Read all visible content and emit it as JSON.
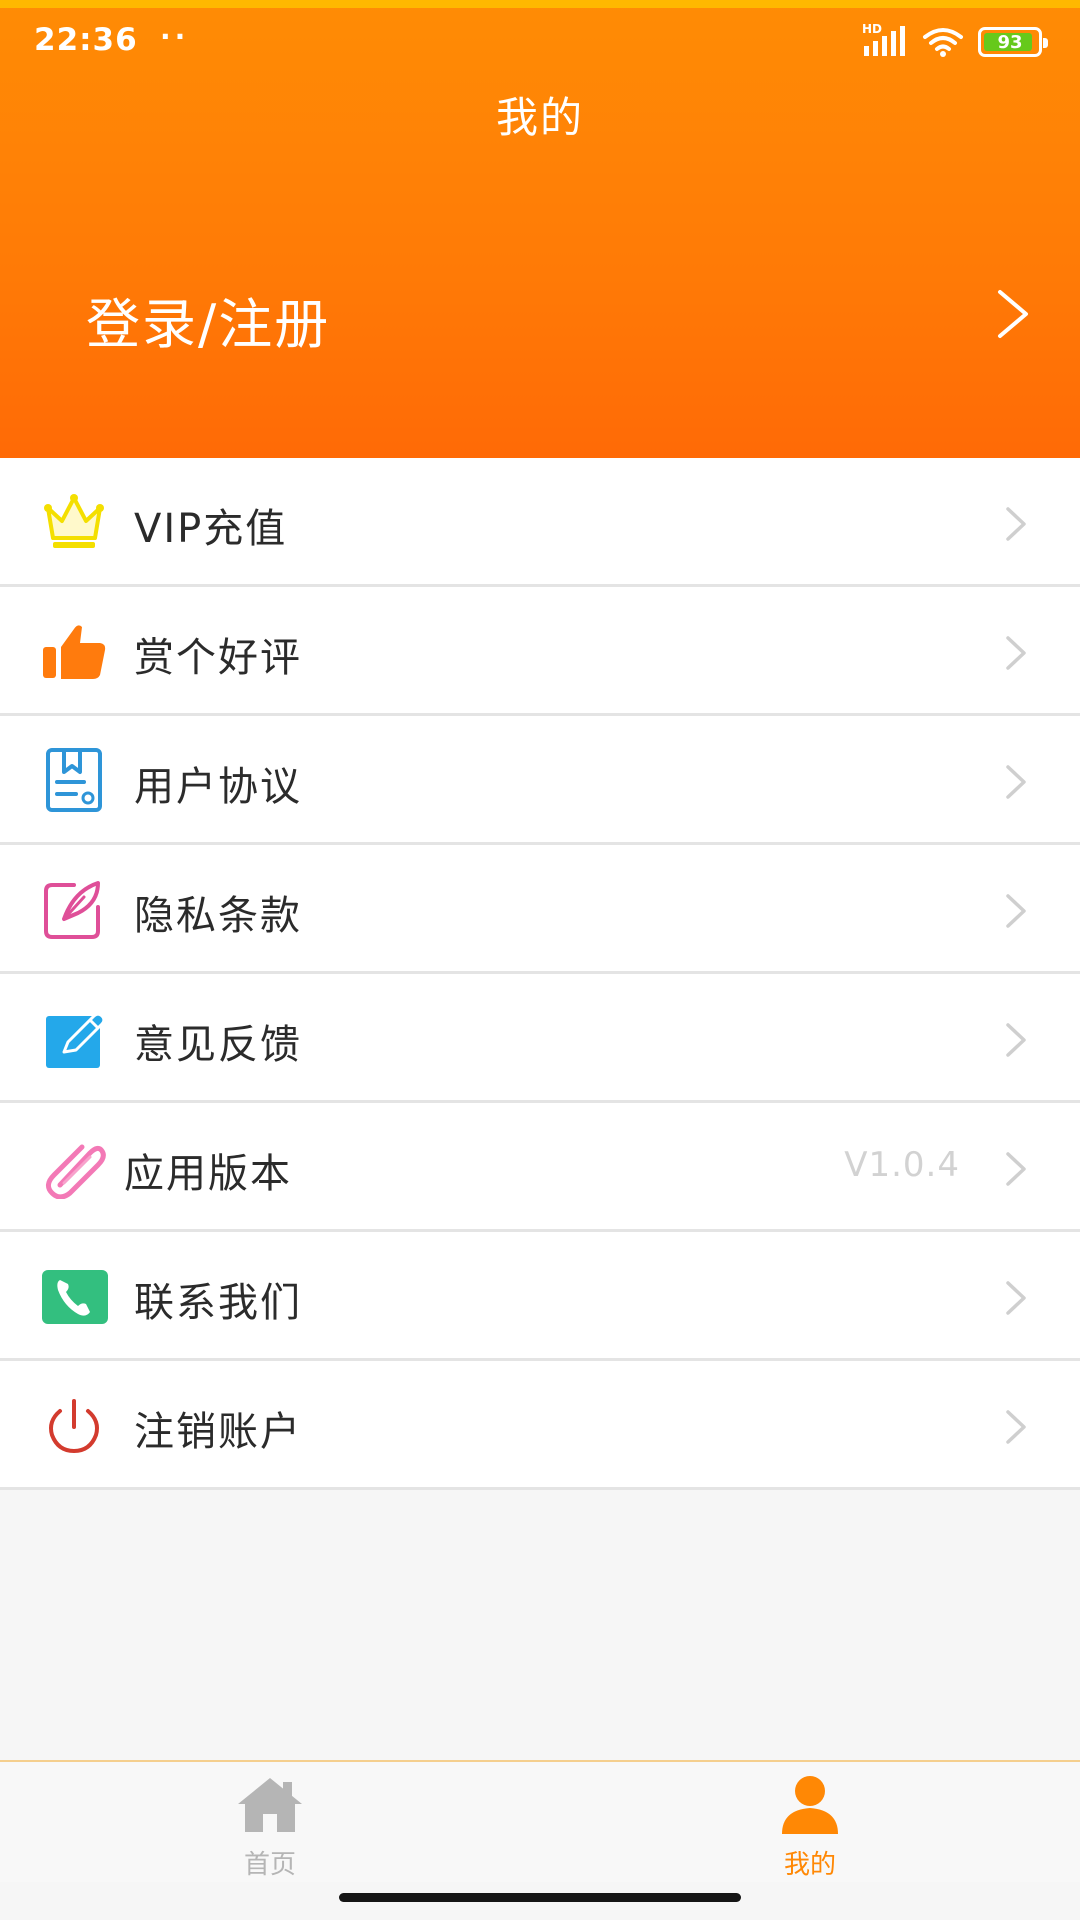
{
  "status_bar": {
    "time": "22:36",
    "dots": "··",
    "network_label": "HD",
    "battery": "93",
    "battery_level": 0.93
  },
  "header": {
    "title": "我的",
    "login_label": "登录/注册"
  },
  "menu": [
    {
      "label": "VIP充值",
      "icon": "crown-icon",
      "value": ""
    },
    {
      "label": "赏个好评",
      "icon": "thumbs-up-icon",
      "value": ""
    },
    {
      "label": "用户协议",
      "icon": "agreement-document-icon",
      "value": ""
    },
    {
      "label": "隐私条款",
      "icon": "privacy-pen-icon",
      "value": ""
    },
    {
      "label": "意见反馈",
      "icon": "feedback-edit-icon",
      "value": ""
    },
    {
      "label": "应用版本",
      "icon": "paperclip-icon",
      "value": "V1.0.4"
    },
    {
      "label": "联系我们",
      "icon": "phone-icon",
      "value": ""
    },
    {
      "label": "注销账户",
      "icon": "power-icon",
      "value": ""
    }
  ],
  "tabbar": {
    "home_label": "首页",
    "mine_label": "我的",
    "home_icon": "house-icon",
    "mine_icon": "person-icon",
    "active": "我的"
  },
  "colors": {
    "header_orange": "#ff7f06",
    "active_tab": "#ff8805",
    "inactive_tab": "#b5b5b5",
    "page_background": "#f6f6f6"
  }
}
